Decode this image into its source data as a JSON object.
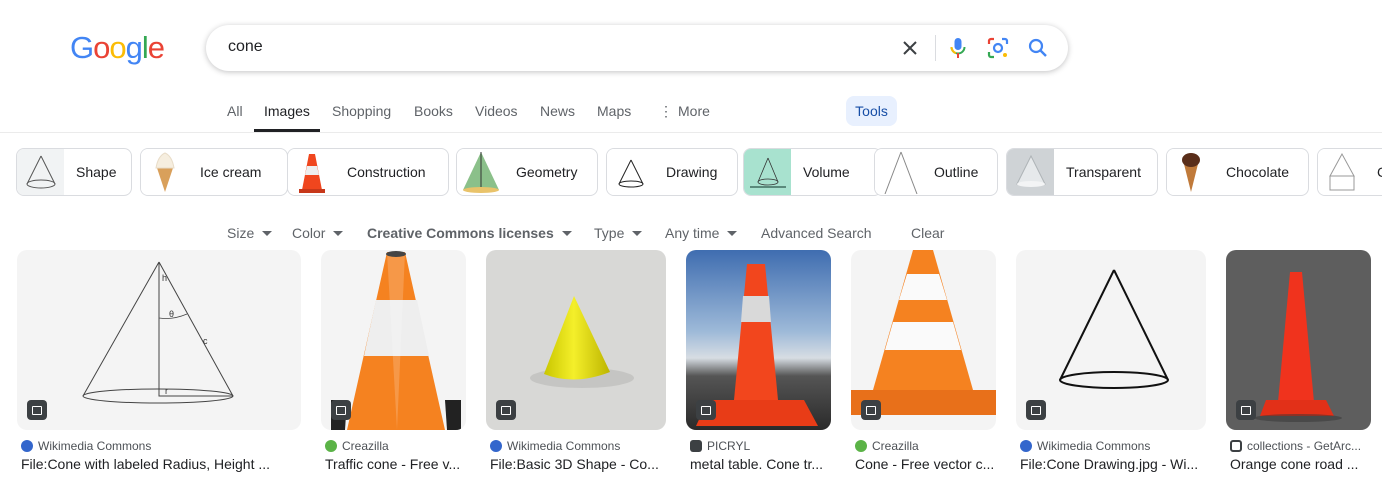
{
  "logo": {
    "letters": [
      "G",
      "o",
      "o",
      "g",
      "l",
      "e"
    ],
    "colors": [
      "#4285F4",
      "#EA4335",
      "#FBBC05",
      "#4285F4",
      "#34A853",
      "#EA4335"
    ]
  },
  "search": {
    "query": "cone",
    "clear_icon": "close-icon",
    "voice_icon": "mic-icon",
    "lens_icon": "camera-lens-icon",
    "search_icon": "search-icon"
  },
  "tabs": [
    {
      "label": "All"
    },
    {
      "label": "Images"
    },
    {
      "label": "Shopping"
    },
    {
      "label": "Books"
    },
    {
      "label": "Videos"
    },
    {
      "label": "News"
    },
    {
      "label": "Maps"
    },
    {
      "label": "More"
    }
  ],
  "tools_label": "Tools",
  "chips": [
    {
      "label": "Shape",
      "thumb": "outline-cone"
    },
    {
      "label": "Ice cream",
      "thumb": "ice-cream"
    },
    {
      "label": "Construction",
      "thumb": "traffic-cone"
    },
    {
      "label": "Geometry",
      "thumb": "green-cone"
    },
    {
      "label": "Drawing",
      "thumb": "outline-cone"
    },
    {
      "label": "Volume",
      "thumb": "teal-diagram"
    },
    {
      "label": "Outline",
      "thumb": "outline-cone"
    },
    {
      "label": "Transparent",
      "thumb": "glass-cone"
    },
    {
      "label": "Chocolate",
      "thumb": "choc-cone"
    },
    {
      "label": "C",
      "thumb": "outline-cone"
    }
  ],
  "filters": [
    {
      "label": "Size",
      "dropdown": true
    },
    {
      "label": "Color",
      "dropdown": true
    },
    {
      "label": "Creative Commons licenses",
      "dropdown": true,
      "bold": true
    },
    {
      "label": "Type",
      "dropdown": true
    },
    {
      "label": "Any time",
      "dropdown": true
    },
    {
      "label": "Advanced Search",
      "dropdown": false
    },
    {
      "label": "Clear",
      "dropdown": false
    }
  ],
  "results": [
    {
      "source": "Wikimedia Commons",
      "title": "File:Cone with labeled Radius, Height ...",
      "source_color": "#3366cc",
      "image": "labeled-cone",
      "labels": [
        "h",
        "θ",
        "c",
        "r"
      ]
    },
    {
      "source": "Creazilla",
      "title": "Traffic cone - Free v...",
      "source_color": "#5bb347",
      "image": "traffic-cone-vector"
    },
    {
      "source": "Wikimedia Commons",
      "title": "File:Basic 3D Shape - Co...",
      "source_color": "#3366cc",
      "image": "yellow-3d-cone"
    },
    {
      "source": "PICRYL",
      "title": "metal table. Cone tr...",
      "source_color": "#3c4043",
      "image": "photo-traffic-cone"
    },
    {
      "source": "Creazilla",
      "title": "Cone - Free vector c...",
      "source_color": "#5bb347",
      "image": "striped-cone-vector"
    },
    {
      "source": "Wikimedia Commons",
      "title": "File:Cone Drawing.jpg - Wi...",
      "source_color": "#3366cc",
      "image": "line-cone-drawing"
    },
    {
      "source": "collections - GetArc...",
      "title": "Orange cone road ...",
      "source_color": "#3c4043",
      "image": "road-cone-photo"
    }
  ]
}
